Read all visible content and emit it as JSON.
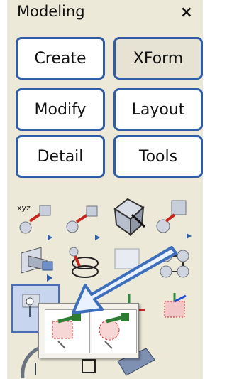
{
  "panel": {
    "title": "Modeling",
    "close_label": "×"
  },
  "buttons": {
    "create": "Create",
    "xform": "XForm",
    "modify": "Modify",
    "layout": "Layout",
    "detail": "Detail",
    "tools": "Tools"
  },
  "tools": [
    "xyz-sphere-icon",
    "line-sphere-icon",
    "box-arrow-icon",
    "cube-sphere-icon",
    "plane-tool-icon",
    "ellipse-tool-icon",
    "blank-tool-icon",
    "circle-pattern-icon",
    "attach-tool-icon",
    "red-tool-icon",
    "axis-tool-icon",
    "red-object-icon"
  ],
  "flyout": {
    "items": [
      "red-box-tool-icon",
      "red-circle-tool-icon"
    ]
  },
  "colors": {
    "panel_bg": "#ece9d8",
    "button_border": "#2f5da8",
    "selection": "#c7d6ee",
    "callout_arrow": "#3e6fbd"
  }
}
